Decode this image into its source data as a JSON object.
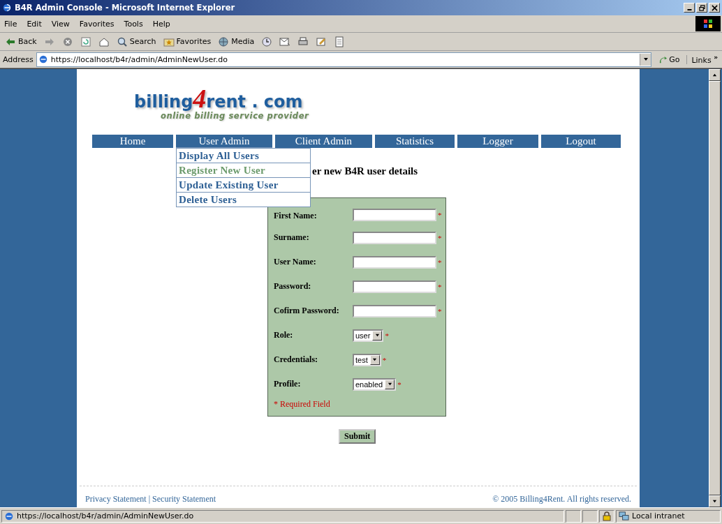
{
  "window": {
    "title": "B4R Admin Console - Microsoft Internet Explorer"
  },
  "menu_bar": [
    "File",
    "Edit",
    "View",
    "Favorites",
    "Tools",
    "Help"
  ],
  "toolbar": [
    {
      "kind": "back",
      "label": "Back"
    },
    {
      "kind": "forward"
    },
    {
      "kind": "stop"
    },
    {
      "kind": "refresh"
    },
    {
      "kind": "home"
    },
    {
      "kind": "search",
      "label": "Search"
    },
    {
      "kind": "favorites",
      "label": "Favorites"
    },
    {
      "kind": "media",
      "label": "Media"
    },
    {
      "kind": "history"
    },
    {
      "kind": "mail"
    },
    {
      "kind": "print"
    },
    {
      "kind": "edit"
    },
    {
      "kind": "discuss"
    }
  ],
  "address_bar": {
    "label": "Address",
    "value": "https://localhost/b4r/admin/AdminNewUser.do",
    "go": "Go",
    "links": "Links",
    "more": "»"
  },
  "logo": {
    "part1": "billing",
    "digit": "4",
    "part2": "rent . com",
    "tagline": "online billing service provider"
  },
  "nav": [
    {
      "label": "Home",
      "expanded": false
    },
    {
      "label": "User Admin",
      "expanded": true,
      "children": [
        {
          "label": "Display All Users",
          "selected": false
        },
        {
          "label": "Register New User",
          "selected": true
        },
        {
          "label": "Update Existing User",
          "selected": false
        },
        {
          "label": "Delete Users",
          "selected": false
        }
      ]
    },
    {
      "label": "Client Admin",
      "expanded": false
    },
    {
      "label": "Statistics",
      "expanded": false
    },
    {
      "label": "Logger",
      "expanded": false
    },
    {
      "label": "Logout",
      "expanded": false
    }
  ],
  "heading": "er new B4R user details",
  "form": {
    "fields": [
      {
        "kind": "text",
        "label": "First Name:",
        "mark": "*"
      },
      {
        "kind": "text",
        "label": "Surname:",
        "mark": "*"
      },
      {
        "kind": "text",
        "label": "User Name:",
        "mark": "*"
      },
      {
        "kind": "password",
        "label": "Password:",
        "mark": "*"
      },
      {
        "kind": "password",
        "label": "Cofirm Password:",
        "mark": "*"
      },
      {
        "kind": "select",
        "label": "Role:",
        "value": "user",
        "mark": "*"
      },
      {
        "kind": "select",
        "label": "Credentials:",
        "value": "test",
        "mark": "*"
      },
      {
        "kind": "select",
        "label": "Profile:",
        "value": "enabled",
        "mark": "*"
      }
    ],
    "note": "* Required Field",
    "submit": "Submit"
  },
  "footer": {
    "links": [
      "Privacy Statement",
      "Security Statement"
    ],
    "separator": "|",
    "copyright": "© 2005 Billing4Rent. All rights reserved."
  },
  "status_bar": {
    "url": "https://localhost/b4r/admin/AdminNewUser.do",
    "zone": "Local intranet"
  }
}
